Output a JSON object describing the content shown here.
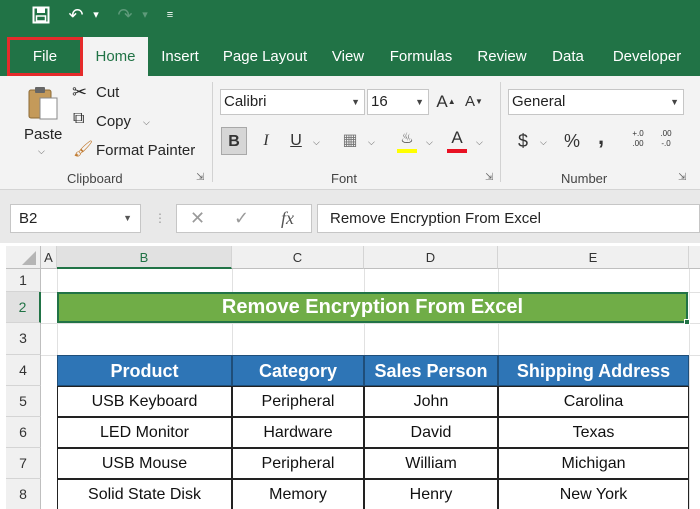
{
  "title_bar": {
    "save_icon": "save-icon",
    "undo_icon": "undo-icon",
    "redo_icon": "redo-icon",
    "customize_icon": "customize-quick-access-icon"
  },
  "tabs": [
    "File",
    "Home",
    "Insert",
    "Page Layout",
    "View",
    "Formulas",
    "Review",
    "Data",
    "Developer"
  ],
  "ribbon": {
    "clipboard": {
      "paste": "Paste",
      "cut": "Cut",
      "copy": "Copy",
      "format_painter": "Format Painter",
      "label": "Clipboard"
    },
    "font": {
      "name": "Calibri",
      "size": "16",
      "bold": "B",
      "italic": "I",
      "underline": "U",
      "label": "Font",
      "grow": "A",
      "shrink": "A",
      "font_color": "A",
      "highlight_color": "#ffff00",
      "text_color": "#e81123"
    },
    "number": {
      "format": "General",
      "currency": "$",
      "percent": "%",
      "comma": ",",
      "inc_decimal": "+.0 .00",
      "dec_decimal": ".00 -.0",
      "label": "Number"
    }
  },
  "formula_bar": {
    "name_box": "B2",
    "fx": "fx",
    "formula": "Remove Encryption From Excel"
  },
  "columns": [
    "A",
    "B",
    "C",
    "D",
    "E"
  ],
  "rows": [
    "1",
    "2",
    "3",
    "4",
    "5",
    "6",
    "7",
    "8"
  ],
  "sheet": {
    "banner": "Remove Encryption From Excel",
    "headers": [
      "Product",
      "Category",
      "Sales Person",
      "Shipping Address"
    ],
    "data": [
      [
        "USB Keyboard",
        "Peripheral",
        "John",
        "Carolina"
      ],
      [
        "LED Monitor",
        "Hardware",
        "David",
        "Texas"
      ],
      [
        "USB Mouse",
        "Peripheral",
        "William",
        "Michigan"
      ],
      [
        "Solid State Disk",
        "Memory",
        "Henry",
        "New York"
      ]
    ]
  },
  "colors": {
    "excel_green": "#217346",
    "banner_green": "#70ad47",
    "header_blue": "#2e75b6",
    "highlight_red": "#e52b2b"
  }
}
